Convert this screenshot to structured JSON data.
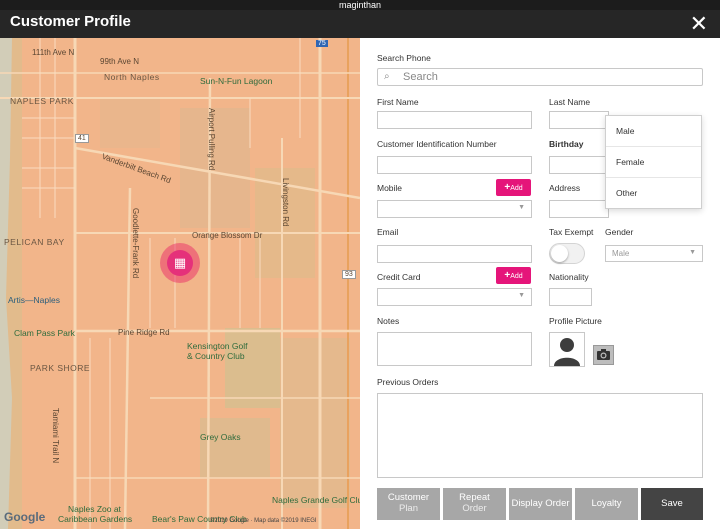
{
  "statusbar": {
    "text": "maginthan"
  },
  "header": {
    "title": "Customer Profile",
    "close_glyph": "✕"
  },
  "map": {
    "labels": {
      "north_naples": "North Naples",
      "sun_n_fun": "Sun-N-Fun Lagoon",
      "naples_park": "NAPLES PARK",
      "pelican_bay": "PELICAN BAY",
      "artis": "Artis—Naples",
      "clam_pass": "Clam Pass Park",
      "park_shore": "PARK SHORE",
      "kensington_1": "Kensington Golf",
      "kensington_2": "& Country Club",
      "grey_oaks": "Grey Oaks",
      "naples_zoo_1": "Naples Zoo at",
      "naples_zoo_2": "Caribbean Gardens",
      "naples_grande": "Naples Grande Golf Club",
      "bears_paw": "Bear's Paw Country Club",
      "route_41": "41",
      "route_75": "75",
      "route_93": "93",
      "vanderbilt": "Vanderbilt Beach Rd",
      "orange_blossom": "Orange Blossom Dr",
      "pine_ridge": "Pine Ridge Rd",
      "goodlette": "Goodlette-Frank Rd",
      "tamiami": "Tamiami Trail N",
      "airport": "Airport Pulling Rd",
      "livingston": "Livingston Rd",
      "st_111th": "111th Ave N",
      "st_99th": "99th Ave N"
    },
    "google": "Google",
    "credit": "©2019 Google · Map data ©2019 INEGI"
  },
  "form": {
    "search_label": "Search Phone",
    "search_placeholder": "Search",
    "first_name_label": "First Name",
    "last_name_label": "Last Name",
    "cin_label": "Customer Identification Number",
    "birthday_label": "Birthday",
    "mobile_label": "Mobile",
    "address_label": "Address",
    "email_label": "Email",
    "tax_exempt_label": "Tax Exempt",
    "tax_exempt_on": false,
    "gender_label": "Gender",
    "gender_value": "Male",
    "gender_options": [
      "Male",
      "Female",
      "Other"
    ],
    "credit_card_label": "Credit Card",
    "nationality_label": "Nationality",
    "notes_label": "Notes",
    "profile_picture_label": "Profile Picture",
    "previous_orders_label": "Previous Orders",
    "add_label": "Add",
    "add_icon": "+"
  },
  "buttons": {
    "customer_plan_1": "Customer",
    "customer_plan_2": "Plan",
    "repeat_order_1": "Repeat",
    "repeat_order_2": "Order",
    "display_order": "Display Order",
    "loyalty": "Loyalty",
    "save": "Save"
  },
  "colors": {
    "accent": "#e5157a",
    "header": "#262626",
    "map": "#f2b58a"
  }
}
